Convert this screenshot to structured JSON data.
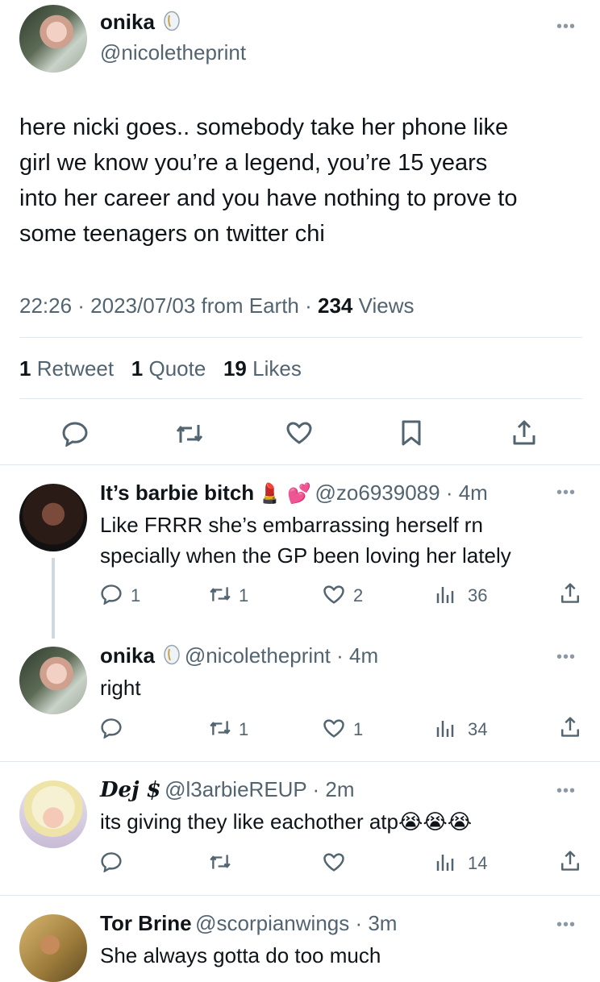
{
  "main_tweet": {
    "name": "onika",
    "handle": "@nicoletheprint",
    "text_lines": [
      "here nicki goes.. somebody take her phone like",
      "girl we know you’re a legend, you’re 15 years",
      "into her career and you have nothing to prove to",
      "some teenagers on twitter chi"
    ],
    "meta": {
      "time_date": "22:26 · 2023/07/03 from Earth ·",
      "views_count": "234",
      "views_label": "Views"
    },
    "stats": {
      "retweets": "1",
      "retweets_label": "Retweet",
      "quotes": "1",
      "quotes_label": "Quote",
      "likes": "19",
      "likes_label": "Likes"
    }
  },
  "replies": [
    {
      "name": "It’s barbie bitch",
      "emoji": "💄 💕",
      "handle_time": "@zo6939089 · 4m",
      "text_lines": [
        "Like FRRR she’s embarrassing herself rn",
        "specially when the GP been loving her lately"
      ],
      "reply_count": "1",
      "retweet_count": "1",
      "like_count": "2",
      "view_count": "36"
    },
    {
      "name": "onika",
      "handle_time": "@nicoletheprint · 4m",
      "text_lines": [
        "right"
      ],
      "reply_count": "",
      "retweet_count": "1",
      "like_count": "1",
      "view_count": "34"
    },
    {
      "name": "Dej $",
      "handle_time": "@l3arbieREUP · 2m",
      "text_lines": [
        "its giving they like eachother atp😭😭😭"
      ],
      "reply_count": "",
      "retweet_count": "",
      "like_count": "",
      "view_count": "14"
    },
    {
      "name": "Tor Brine",
      "handle_time": "@scorpianwings · 3m",
      "text_lines": [
        "She always gotta do too much"
      ]
    }
  ]
}
